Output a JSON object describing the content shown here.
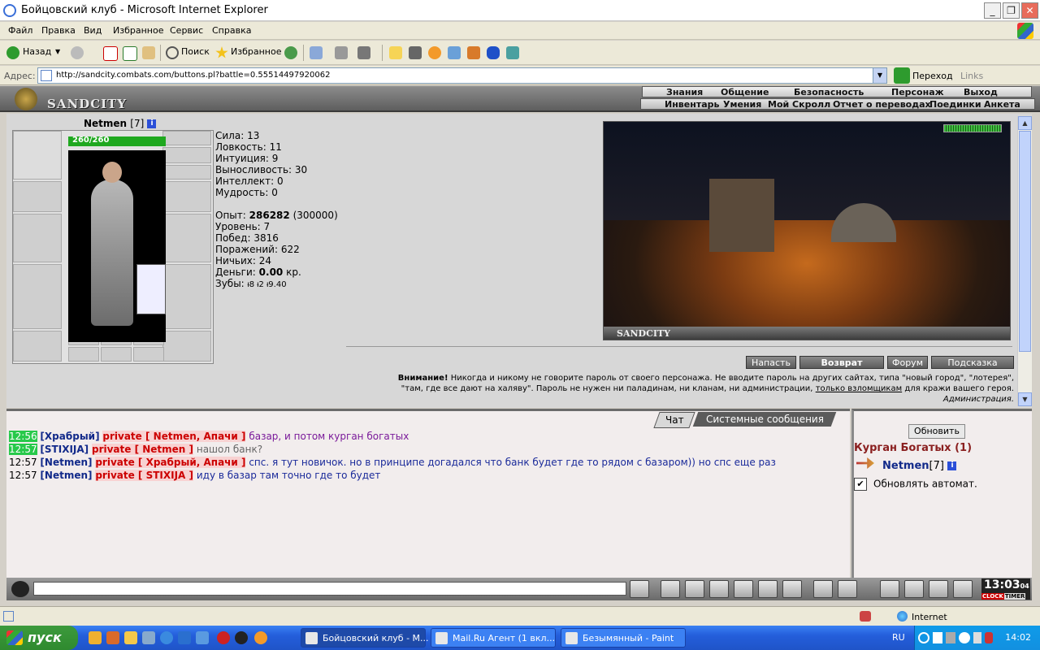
{
  "window": {
    "title": "Бойцовский клуб - Microsoft Internet Explorer",
    "min": "_",
    "max": "❐",
    "close": "✕"
  },
  "menu": [
    "Файл",
    "Правка",
    "Вид",
    "Избранное",
    "Сервис",
    "Справка"
  ],
  "toolbar": {
    "back": "Назад",
    "search": "Поиск",
    "favorites": "Избранное"
  },
  "address": {
    "label": "Адрес:",
    "url": "http://sandcity.combats.com/buttons.pl?battle=0.55514497920062",
    "go": "Переход",
    "links": "Links"
  },
  "game": {
    "name": "SANDCITY",
    "nav_top": [
      "Знания",
      "Общение",
      "Безопасность",
      "Персонаж",
      "Выход"
    ],
    "nav_bottom": [
      "Инвентарь",
      "Умения",
      "Мой Скролл",
      "Отчет о переводах",
      "Поединки",
      "Анкета"
    ]
  },
  "character": {
    "name": "Netmen",
    "level": "[7]",
    "info": "i",
    "hp": "260/260",
    "stats": [
      {
        "label": "Сила:",
        "value": "13"
      },
      {
        "label": "Ловкость:",
        "value": "11"
      },
      {
        "label": "Интуиция:",
        "value": "9"
      },
      {
        "label": "Выносливость:",
        "value": "30"
      },
      {
        "label": "Интеллект:",
        "value": "0"
      },
      {
        "label": "Мудрость:",
        "value": "0"
      }
    ],
    "experience_label": "Опыт:",
    "experience": "286282",
    "experience_next": "(300000)",
    "level_label": "Уровень:",
    "level_value": "7",
    "wins_label": "Побед:",
    "wins": "3816",
    "losses_label": "Поражений:",
    "losses": "622",
    "draws_label": "Ничьих:",
    "draws": "24",
    "money_label": "Деньги:",
    "money": "0.00",
    "money_unit": "кр.",
    "teeth_label": "Зубы:",
    "teeth": "ᵼ8 ᵼ2 ᵼ9.40"
  },
  "scene": {
    "label": "SANDCITY"
  },
  "actions": [
    "Напасть",
    "Возврат",
    "Форум",
    "Подсказка"
  ],
  "warning": {
    "bold": "Внимание!",
    "line1": "Никогда и никому не говорите пароль от своего персонажа. Не вводите пароль на других сайтах, типа \"новый город\", \"лотерея\",",
    "line2a": "\"там, где все дают на халяву\". Пароль не нужен ни паладинам, ни кланам, ни администрации,",
    "line2link": "только взломщикам",
    "line2b": "для кражи вашего героя.",
    "signature": "Администрация."
  },
  "chat": {
    "tabs": [
      "Чат",
      "Системные сообщения"
    ],
    "messages": [
      {
        "time": "12:56",
        "user": "[Храбрый]",
        "private": "private [ Netmen, Апачи ]",
        "text": "базар, и потом курган богатых",
        "time_hl": true,
        "color": "#7a1a9a"
      },
      {
        "time": "12:57",
        "user": "[STIXIJA]",
        "private": "private [ Netmen ]",
        "text": "нашол банк?",
        "time_hl": true,
        "color": "#666666"
      },
      {
        "time": "12:57",
        "user": "[Netmen]",
        "private": "private [ Храбрый, Апачи ]",
        "text": "спс. я тут новичок. но в принципе догадался что банк будет где то рядом с базаром)) но спс еще раз",
        "time_hl": false,
        "color": "#1a2a9a"
      },
      {
        "time": "12:57",
        "user": "[Netmen]",
        "private": "private [ STIXIJA ]",
        "text": "иду в базар там точно где то будет",
        "time_hl": false,
        "color": "#1a2a9a"
      }
    ]
  },
  "side": {
    "refresh": "Обновить",
    "room": "Курган Богатых (1)",
    "user": "Netmen",
    "user_level": "[7]",
    "auto": "Обновлять автомат.",
    "auto_check": "✔"
  },
  "clock": {
    "time": "13:03",
    "sec": "04",
    "label_a": "CLOCK",
    "label_b": "TIMER"
  },
  "status": {
    "zone": "Internet"
  },
  "taskbar": {
    "start": "пуск",
    "tasks": [
      "Бойцовский клуб - М...",
      "Mail.Ru Агент (1 вкл...",
      "Безымянный - Paint"
    ],
    "lang": "RU",
    "time": "14:02"
  }
}
